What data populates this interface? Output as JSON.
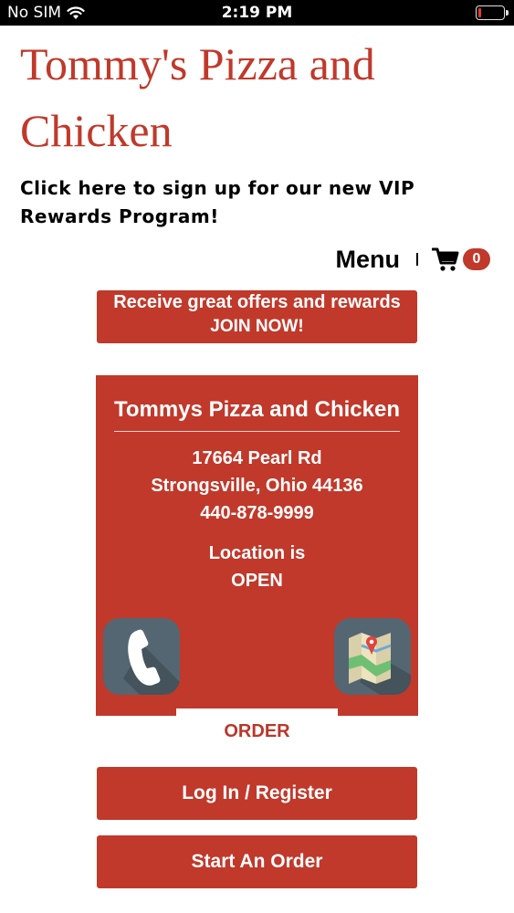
{
  "status_bar": {
    "carrier": "No SIM",
    "time": "2:19 PM",
    "battery_level": 0.1
  },
  "header": {
    "site_title": "Tommy's Pizza and Chicken",
    "vip_link": "Click here to sign up for our new VIP Rewards Program!"
  },
  "nav": {
    "menu_label": "Menu",
    "cart_count": "0"
  },
  "join_banner": {
    "line1": "Receive great offers and rewards",
    "line2": "JOIN NOW!"
  },
  "location": {
    "name": "Tommys Pizza and Chicken",
    "street": "17664 Pearl Rd",
    "city_state_zip": "Strongsville, Ohio 44136",
    "phone": "440-878-9999",
    "status_prefix": "Location is",
    "status": "OPEN"
  },
  "actions": {
    "order_label": "ORDER",
    "login_label": "Log In / Register",
    "start_order_label": "Start An Order"
  },
  "colors": {
    "brand_red": "#c0392b",
    "icon_bg": "#546672"
  },
  "icons": [
    "wifi-icon",
    "battery-icon",
    "cart-icon",
    "phone-icon",
    "map-icon"
  ]
}
